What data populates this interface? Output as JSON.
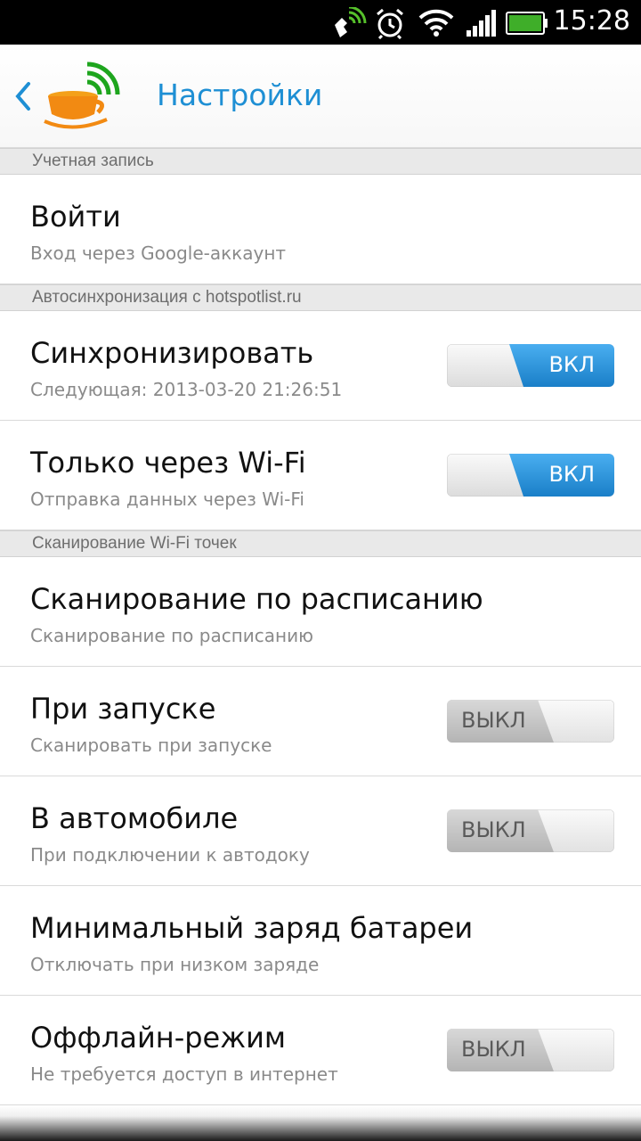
{
  "status_bar": {
    "time": "15:28",
    "icons": [
      "satellite-phone-icon",
      "alarm-clock-icon",
      "wifi-icon",
      "signal-icon",
      "battery-icon"
    ],
    "battery_color": "#3fae29"
  },
  "action_bar": {
    "title": "Настройки",
    "title_color": "#1e8fd4",
    "back_icon": "chevron-left-icon",
    "logo_icon": "coffee-cup-wifi-icon"
  },
  "sections": [
    {
      "header": "Учетная запись"
    },
    {
      "header": "Автосинхронизация с hotspotlist.ru"
    },
    {
      "header": "Сканирование Wi-Fi точек"
    }
  ],
  "rows": {
    "login": {
      "title": "Войти",
      "subtitle": "Вход через Google-аккаунт"
    },
    "sync": {
      "title": "Синхронизировать",
      "subtitle": "Следующая: 2013-03-20 21:26:51",
      "toggle": "ВКЛ",
      "state": "on"
    },
    "wifi_only": {
      "title": "Только через Wi-Fi",
      "subtitle": "Отправка данных через Wi-Fi",
      "toggle": "ВКЛ",
      "state": "on"
    },
    "scheduled_scan": {
      "title": "Сканирование по расписанию",
      "subtitle": "Сканирование по расписанию"
    },
    "on_start": {
      "title": "При запуске",
      "subtitle": "Сканировать при запуске",
      "toggle": "ВЫКЛ",
      "state": "off"
    },
    "in_car": {
      "title": "В автомобиле",
      "subtitle": "При подключении к автодоку",
      "toggle": "ВЫКЛ",
      "state": "off"
    },
    "min_battery": {
      "title": "Минимальный заряд батареи",
      "subtitle": "Отключать при низком заряде"
    },
    "offline": {
      "title": "Оффлайн-режим",
      "subtitle": "Не требуется доступ в интернет",
      "toggle": "ВЫКЛ",
      "state": "off"
    }
  },
  "colors": {
    "toggle_on": "#2a93d8",
    "section_bg": "#e9e9e9"
  }
}
